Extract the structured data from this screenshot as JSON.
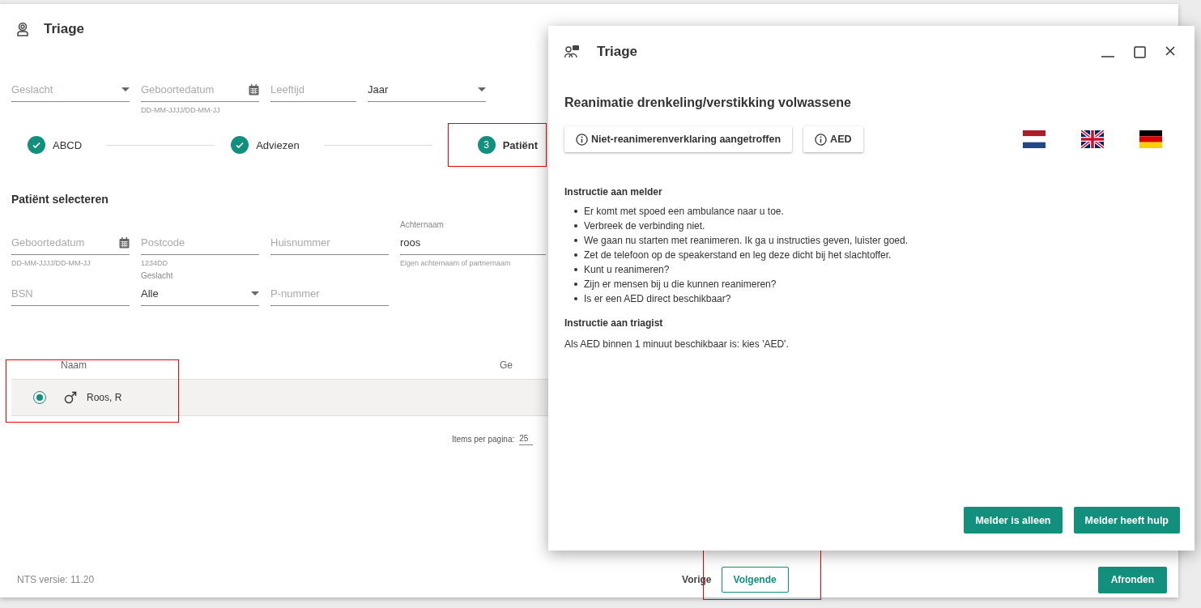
{
  "main": {
    "title": "Triage",
    "filters": [
      {
        "kind": "select",
        "placeholder": "Geslacht"
      },
      {
        "kind": "date",
        "placeholder": "Geboortedatum",
        "hint": "DD-MM-JJJJ/DD-MM-JJ"
      },
      {
        "kind": "text",
        "placeholder": "Leeftijd"
      },
      {
        "kind": "select",
        "value": "Jaar"
      }
    ],
    "steps": [
      {
        "label": "ABCD",
        "done": true,
        "selected": false,
        "highlighted": false
      },
      {
        "label": "Adviezen",
        "done": true,
        "selected": false,
        "highlighted": false
      },
      {
        "label": "Patiënt",
        "number": "3",
        "done": false,
        "selected": true,
        "highlighted": true
      }
    ],
    "section_title": "Patiënt selecteren",
    "search_rows": [
      [
        {
          "kind": "date",
          "placeholder": "Geboortedatum",
          "hint": "DD-MM-JJJJ/DD-MM-JJ"
        },
        {
          "kind": "text",
          "placeholder": "Postcode",
          "hint": "1234DD"
        },
        {
          "kind": "text",
          "placeholder": "Huisnummer"
        },
        {
          "kind": "text",
          "label": "Achternaam",
          "value": "roos",
          "hint": "Eigen achternaam of partnernaam"
        }
      ],
      [
        {
          "kind": "text",
          "placeholder": "BSN"
        },
        {
          "kind": "select",
          "label": "Geslacht",
          "value": "Alle"
        },
        {
          "kind": "text",
          "placeholder": "P-nummer"
        }
      ]
    ],
    "table": {
      "columns": [
        "Naam",
        "Ge"
      ],
      "rows": [
        {
          "name": "Roos, R",
          "selected": true,
          "highlighted": true
        }
      ]
    },
    "pagination": {
      "label": "Items per pagina:",
      "value": "25"
    },
    "footer": {
      "version": "NTS versie: 11.20",
      "back": "Vorige",
      "next": "Volgende",
      "next_highlighted": true,
      "finish": "Afronden"
    }
  },
  "dialog": {
    "title": "Triage",
    "heading": "Reanimatie drenkeling/verstikking volwassene",
    "info_buttons": [
      "Niet-reanimerenverklaring aangetroffen",
      "AED"
    ],
    "languages": [
      {
        "kind": "nl"
      },
      {
        "kind": "gb"
      },
      {
        "kind": "de"
      }
    ],
    "sections": [
      {
        "title": "Instructie aan melder",
        "kind": "list",
        "items": [
          "Er komt met spoed een ambulance naar u toe.",
          "Verbreek de verbinding niet.",
          "We gaan nu starten met reanimeren. Ik ga u instructies geven, luister goed.",
          "Zet de telefoon op de speakerstand en leg deze dicht bij het slachtoffer.",
          "Kunt u reanimeren?",
          "Zijn er mensen bij u die kunnen reanimeren?",
          "Is er een AED direct beschikbaar?"
        ]
      },
      {
        "title": "Instructie aan triagist",
        "kind": "text",
        "text": "Als AED binnen 1 minuut beschikbaar is: kies 'AED'."
      }
    ],
    "actions": [
      "Melder is alleen",
      "Melder heeft hulp"
    ]
  }
}
